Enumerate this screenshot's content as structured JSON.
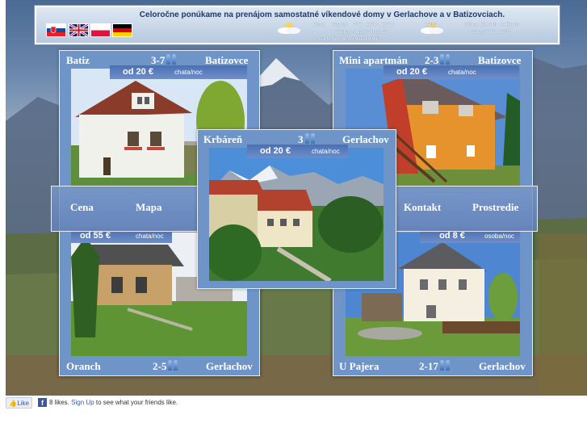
{
  "header": {
    "title": "Celoročne ponúkame na prenájom samostatné víkendové domy v Gerlachove a v Batizovciach.",
    "flags": [
      "slovak-flag-icon",
      "english-flag-icon",
      "polish-flag-icon",
      "german-flag-icon"
    ],
    "weather_today": {
      "label": "Dnes",
      "temp_label": "Teploty:",
      "temp_value": "7°C - 16°C ( 16°C )",
      "wind": "Vietor: N 13.67 km/h 15",
      "humidity": "Vzduch: 60% 1015.92Pa 9.99°"
    },
    "weather_tomorrow": {
      "label": "Zajtra",
      "sun": "Slnko: 4:34 am - 8:46 pm",
      "temp": "Teploty: 6°C - 17°C"
    }
  },
  "panels": {
    "batiz": {
      "name": "Batiz",
      "capacity": "3-7",
      "location": "Batizovce",
      "price": "od 20 €",
      "unit": "chata/noc"
    },
    "mini": {
      "name": "Mini apartmán",
      "capacity": "2-3",
      "location": "Batizovce",
      "price": "od 20 €",
      "unit": "chata/noc"
    },
    "krbaren": {
      "name": "Krbáreň",
      "capacity": "3",
      "location": "Gerlachov",
      "price": "od 20 €",
      "unit": "chata/noc"
    },
    "oranch": {
      "name": "Oranch",
      "capacity": "2-5",
      "location": "Gerlachov",
      "price": "od 55 €",
      "unit": "chata/noc"
    },
    "upajera": {
      "name": "U Pajera",
      "capacity": "2-17",
      "location": "Gerlachov",
      "price": "od 8 €",
      "unit": "osoba/noc"
    }
  },
  "nav": {
    "cena": "Cena",
    "mapa": "Mapa",
    "kontakt": "Kontakt",
    "prostredie": "Prostredie"
  },
  "facebook": {
    "like_label": "Like",
    "likes_text": "8 likes.",
    "signup_label": "Sign Up",
    "suffix": "to see what your friends like."
  }
}
